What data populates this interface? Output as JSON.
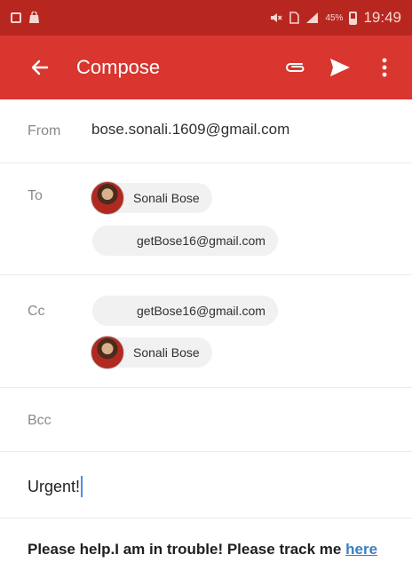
{
  "status_bar": {
    "battery": "45%",
    "time": "19:49"
  },
  "app_bar": {
    "title": "Compose",
    "icons": [
      "arrow-left-icon",
      "paperclip-icon",
      "send-icon",
      "more-vert-icon"
    ]
  },
  "compose": {
    "from": {
      "label": "From",
      "value": "bose.sonali.1609@gmail.com"
    },
    "to": {
      "label": "To",
      "recipients": [
        {
          "name": "Sonali Bose",
          "has_avatar": true
        },
        {
          "name": "getBose16@gmail.com",
          "has_avatar": false
        }
      ]
    },
    "cc": {
      "label": "Cc",
      "recipients": [
        {
          "name": "getBose16@gmail.com",
          "has_avatar": false
        },
        {
          "name": "Sonali Bose",
          "has_avatar": true
        }
      ]
    },
    "bcc": {
      "label": "Bcc"
    },
    "subject": "Urgent!",
    "body": {
      "text": "Please help.I am in trouble! Please track me ",
      "link_text": "here"
    }
  },
  "colors": {
    "status_bar": "#b8271f",
    "app_bar": "#d8362e",
    "link": "#3a7fc1",
    "cursor": "#4d8af0"
  }
}
